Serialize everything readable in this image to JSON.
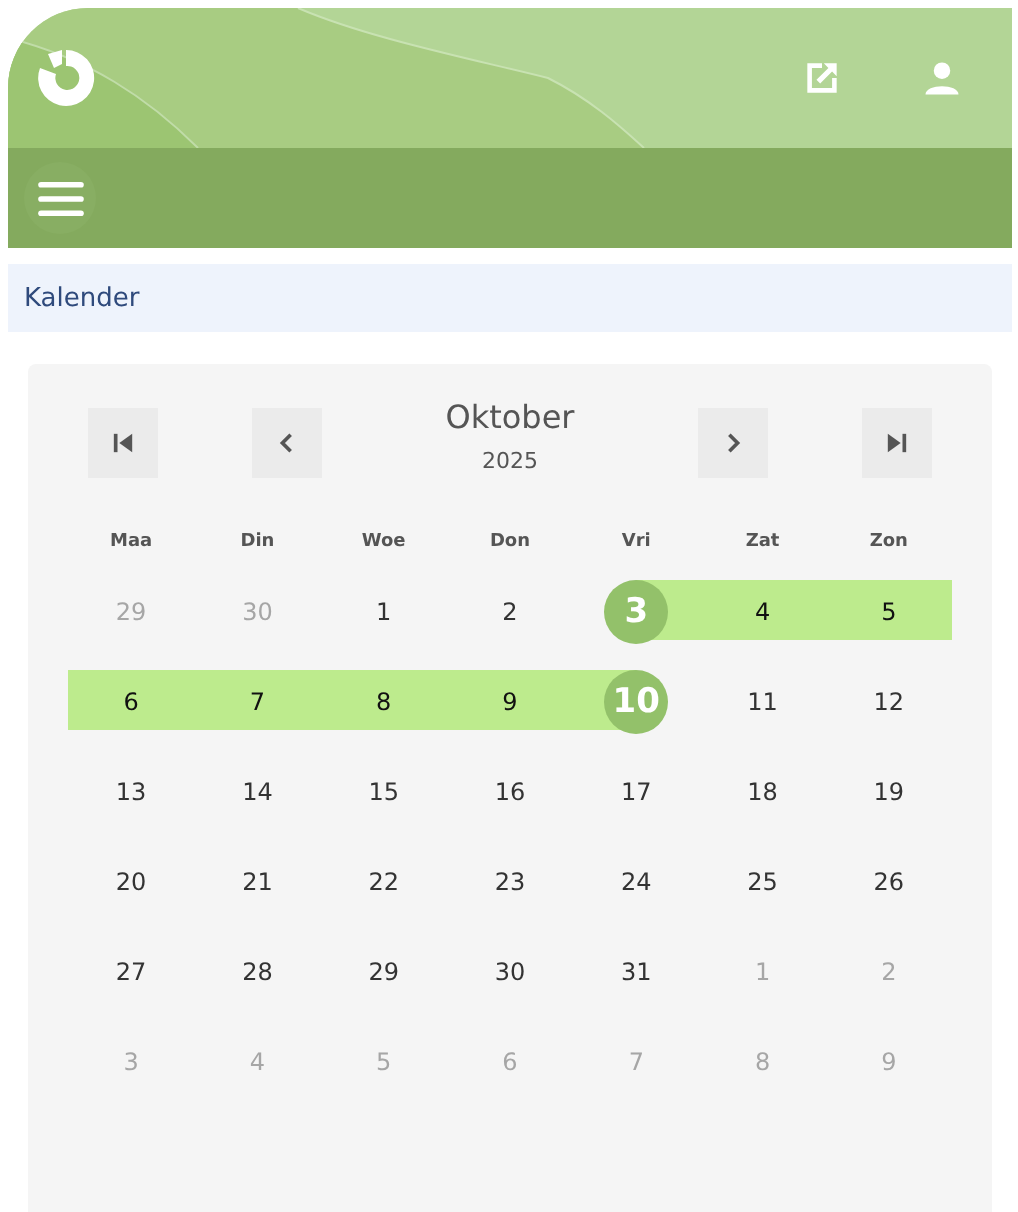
{
  "breadcrumb": "Kalender",
  "calendar": {
    "month": "Oktober",
    "year": "2025",
    "weekdays": [
      "Maa",
      "Din",
      "Woe",
      "Don",
      "Vri",
      "Zat",
      "Zon"
    ],
    "weeks": [
      [
        {
          "day": "29",
          "kind": "outside"
        },
        {
          "day": "30",
          "kind": "outside"
        },
        {
          "day": "1",
          "kind": "day"
        },
        {
          "day": "2",
          "kind": "day"
        },
        {
          "day": "3",
          "kind": "range_end"
        },
        {
          "day": "4",
          "kind": "range"
        },
        {
          "day": "5",
          "kind": "range"
        }
      ],
      [
        {
          "day": "6",
          "kind": "range"
        },
        {
          "day": "7",
          "kind": "range"
        },
        {
          "day": "8",
          "kind": "range"
        },
        {
          "day": "9",
          "kind": "range"
        },
        {
          "day": "10",
          "kind": "range_end"
        },
        {
          "day": "11",
          "kind": "day"
        },
        {
          "day": "12",
          "kind": "day"
        }
      ],
      [
        {
          "day": "13",
          "kind": "day"
        },
        {
          "day": "14",
          "kind": "day"
        },
        {
          "day": "15",
          "kind": "day"
        },
        {
          "day": "16",
          "kind": "day"
        },
        {
          "day": "17",
          "kind": "day"
        },
        {
          "day": "18",
          "kind": "day"
        },
        {
          "day": "19",
          "kind": "day"
        }
      ],
      [
        {
          "day": "20",
          "kind": "day"
        },
        {
          "day": "21",
          "kind": "day"
        },
        {
          "day": "22",
          "kind": "day"
        },
        {
          "day": "23",
          "kind": "day"
        },
        {
          "day": "24",
          "kind": "day"
        },
        {
          "day": "25",
          "kind": "day"
        },
        {
          "day": "26",
          "kind": "day"
        }
      ],
      [
        {
          "day": "27",
          "kind": "day"
        },
        {
          "day": "28",
          "kind": "day"
        },
        {
          "day": "29",
          "kind": "day"
        },
        {
          "day": "30",
          "kind": "day"
        },
        {
          "day": "31",
          "kind": "day"
        },
        {
          "day": "1",
          "kind": "outside"
        },
        {
          "day": "2",
          "kind": "outside"
        }
      ],
      [
        {
          "day": "3",
          "kind": "outside"
        },
        {
          "day": "4",
          "kind": "outside"
        },
        {
          "day": "5",
          "kind": "outside"
        },
        {
          "day": "6",
          "kind": "outside"
        },
        {
          "day": "7",
          "kind": "outside"
        },
        {
          "day": "8",
          "kind": "outside"
        },
        {
          "day": "9",
          "kind": "outside"
        }
      ]
    ]
  }
}
